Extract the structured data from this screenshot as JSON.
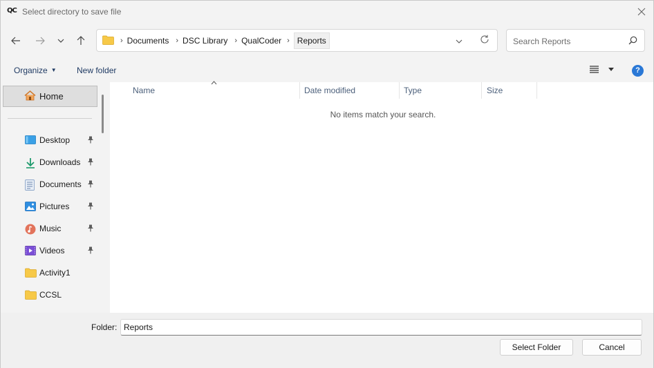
{
  "window": {
    "title": "Select directory to save file",
    "app_icon_text": "QC"
  },
  "nav": {
    "breadcrumbs": [
      "Documents",
      "DSC Library",
      "QualCoder",
      "Reports"
    ],
    "search_placeholder": "Search Reports"
  },
  "toolbar": {
    "organize_label": "Organize",
    "new_folder_label": "New folder"
  },
  "sidebar": {
    "home_label": "Home",
    "items": [
      {
        "label": "Desktop",
        "icon": "desktop-icon",
        "pinned": true
      },
      {
        "label": "Downloads",
        "icon": "downloads-icon",
        "pinned": true
      },
      {
        "label": "Documents",
        "icon": "documents-icon",
        "pinned": true
      },
      {
        "label": "Pictures",
        "icon": "pictures-icon",
        "pinned": true
      },
      {
        "label": "Music",
        "icon": "music-icon",
        "pinned": true
      },
      {
        "label": "Videos",
        "icon": "videos-icon",
        "pinned": true
      },
      {
        "label": "Activity1",
        "icon": "folder-icon",
        "pinned": false
      },
      {
        "label": "CCSL",
        "icon": "folder-icon",
        "pinned": false
      }
    ]
  },
  "filelist": {
    "columns": [
      "Name",
      "Date modified",
      "Type",
      "Size"
    ],
    "empty_message": "No items match your search."
  },
  "footer": {
    "folder_label": "Folder:",
    "folder_value": "Reports",
    "select_button": "Select Folder",
    "cancel_button": "Cancel"
  },
  "colors": {
    "accent": "#2a78d6",
    "folder": "#f7c948",
    "command_text": "#1f3a63"
  }
}
